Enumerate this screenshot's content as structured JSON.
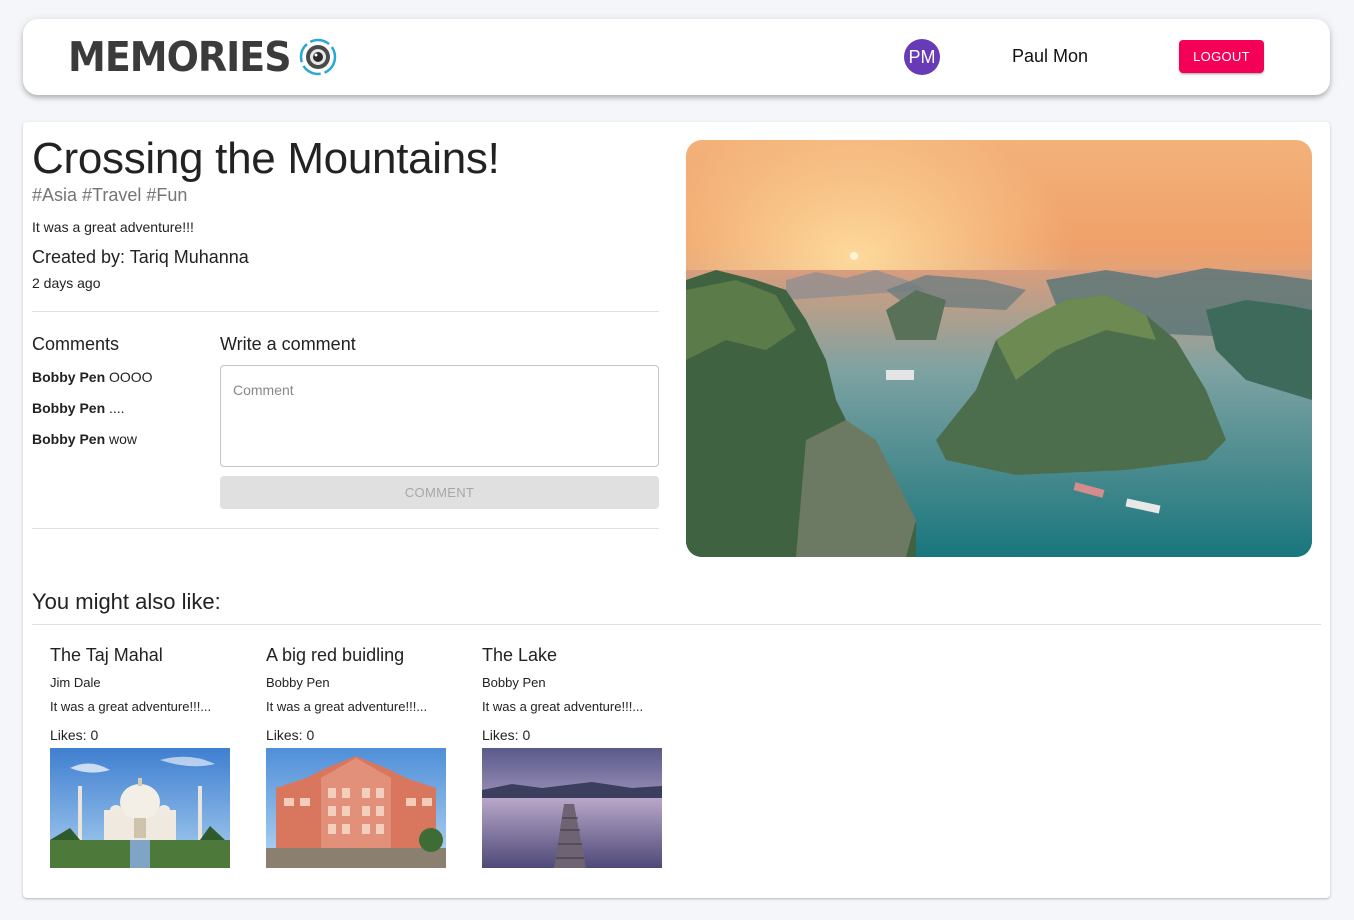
{
  "header": {
    "brand": "MEMORIES",
    "avatar_initials": "PM",
    "user_name": "Paul Mon",
    "logout_label": "LOGOUT"
  },
  "post": {
    "title": "Crossing the Mountains!",
    "tags": [
      "#Asia",
      "#Travel",
      "#Fun"
    ],
    "message": "It was a great adventure!!!",
    "created_by": "Created by: Tariq Muhanna",
    "created_at": "2 days ago"
  },
  "comments": {
    "heading": "Comments",
    "items": [
      {
        "author": "Bobby Pen",
        "text": "OOOO"
      },
      {
        "author": "Bobby Pen",
        "text": "...."
      },
      {
        "author": "Bobby Pen",
        "text": "wow"
      }
    ],
    "write_heading": "Write a comment",
    "input_placeholder": "Comment",
    "input_value": "",
    "submit_label": "COMMENT"
  },
  "recommended": {
    "heading": "You might also like:",
    "items": [
      {
        "title": "The Taj Mahal",
        "author": "Jim Dale",
        "message": "It was a great adventure!!!...",
        "likes": "Likes: 0"
      },
      {
        "title": "A big red buidling",
        "author": "Bobby Pen",
        "message": "It was a great adventure!!!...",
        "likes": "Likes: 0"
      },
      {
        "title": "The Lake",
        "author": "Bobby Pen",
        "message": "It was a great adventure!!!...",
        "likes": "Likes: 0"
      }
    ]
  },
  "colors": {
    "avatar": "#673ab7",
    "logout": "#f50057",
    "disabled_button": "#e0e0e0"
  },
  "icons": {
    "logo": "camera-lens-icon"
  }
}
